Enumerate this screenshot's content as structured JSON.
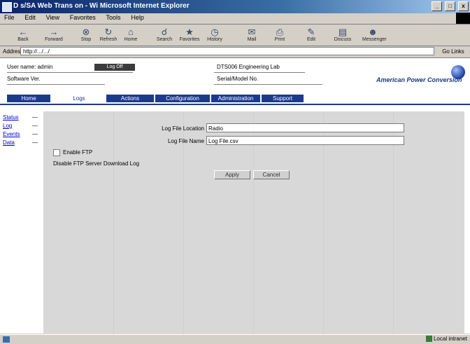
{
  "window": {
    "title": "D s/SA Web Trans on - Wi Microsoft Internet Explorer",
    "controls": [
      "_",
      "□",
      "x"
    ]
  },
  "menu": {
    "items": [
      "File",
      "Edit",
      "View",
      "Favorites",
      "Tools",
      "Help"
    ]
  },
  "toolbar": {
    "buttons": [
      {
        "label": "Back",
        "icon": "back-arrow"
      },
      {
        "label": "Forward",
        "icon": "forward-arrow"
      },
      {
        "label": "Stop",
        "icon": "stop-icon"
      },
      {
        "label": "Refresh",
        "icon": "refresh-icon"
      },
      {
        "label": "Home",
        "icon": "home-icon"
      },
      {
        "label": "Search",
        "icon": "search-icon"
      },
      {
        "label": "Favorites",
        "icon": "favorites-icon"
      },
      {
        "label": "History",
        "icon": "history-icon"
      },
      {
        "label": "Mail",
        "icon": "mail-icon"
      },
      {
        "label": "Print",
        "icon": "print-icon"
      },
      {
        "label": "Edit",
        "icon": "edit-icon"
      },
      {
        "label": "Discuss",
        "icon": "discuss-icon"
      },
      {
        "label": "Messenger",
        "icon": "messenger-icon"
      }
    ]
  },
  "address": {
    "label": "Address",
    "url": "http://.../.../",
    "go_label": "Go Links"
  },
  "header": {
    "row1_left": "User name: admin",
    "row1_box": "Log Off",
    "row1_mid": "DTS006 Engineering Lab",
    "row2_left": "Software Ver.",
    "row2_mid": "Serial/Model No.",
    "brand": "American Power Conversion"
  },
  "tabs": [
    {
      "label": "Home",
      "active": false
    },
    {
      "label": "Logs",
      "active": true
    },
    {
      "label": "Actions",
      "active": false
    },
    {
      "label": "Configuration",
      "active": false
    },
    {
      "label": "Administration",
      "active": false
    },
    {
      "label": "Support",
      "active": false
    }
  ],
  "leftnav": {
    "items": [
      "Status",
      "Log",
      "Events",
      "Data"
    ]
  },
  "form": {
    "fields": [
      {
        "label": "Log File Location",
        "value": "Radio"
      },
      {
        "label": "Log File Name",
        "value": "Log File.csv"
      }
    ],
    "checkbox_label": "Enable FTP",
    "note": "Disable FTP Server Download Log",
    "buttons": [
      "Apply",
      "Cancel"
    ]
  },
  "status": {
    "zone": "Local intranet"
  },
  "colors": {
    "tab_bg": "#1c3a8c",
    "content_bg": "#d8d8d8",
    "titlebar": "#0a246a"
  }
}
